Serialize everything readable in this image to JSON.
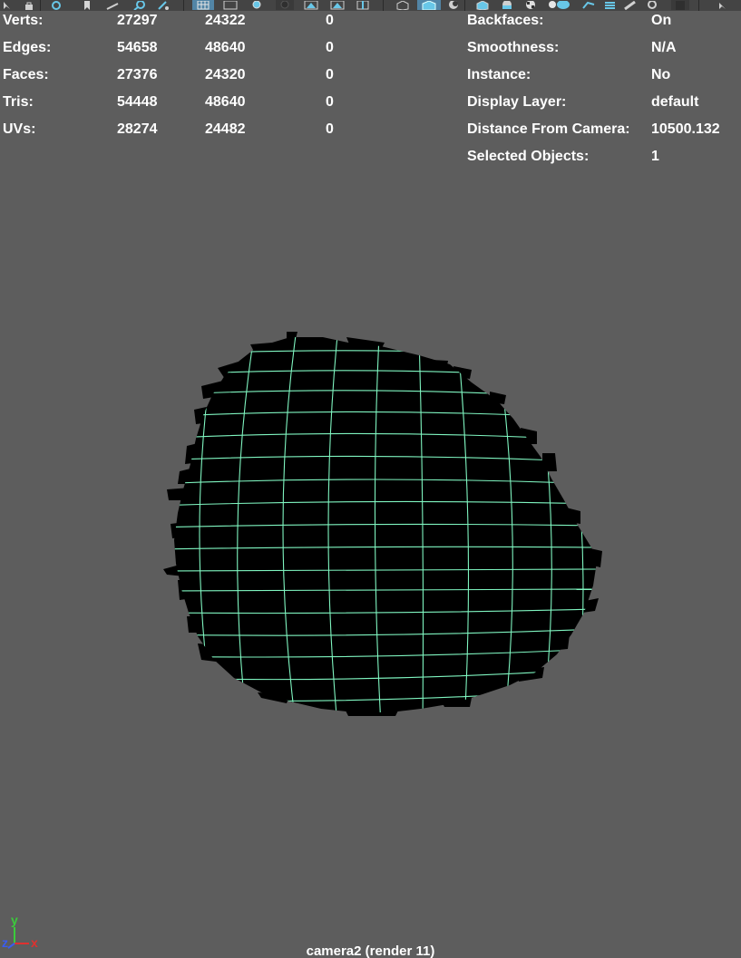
{
  "toolbar": {
    "icons": [
      "select-arrow-icon",
      "lock-icon",
      "snap-settings-icon",
      "bookmark-icon",
      "measure-icon",
      "search-icon",
      "paint-icon",
      "wireframe-grid-icon",
      "film-gate-icon",
      "circle-icon",
      "camera-icon",
      "image-plane-icon",
      "xray-icon",
      "cube-wireframe-icon",
      "cube-shaded-icon",
      "texture-icon",
      "cube-smooth-icon",
      "light-icon",
      "shadow-icon",
      "checker-icon",
      "lightbulb-icon",
      "globe-icon",
      "ambient-occlusion-icon",
      "motion-blur-icon",
      "anti-alias-icon",
      "depth-icon",
      "exposure-icon",
      "gamma-icon",
      "arrow-icon"
    ]
  },
  "hud": {
    "stats": [
      {
        "label": "Verts:",
        "c1": "27297",
        "c2": "24322",
        "c3": "0"
      },
      {
        "label": "Edges:",
        "c1": "54658",
        "c2": "48640",
        "c3": "0"
      },
      {
        "label": "Faces:",
        "c1": "27376",
        "c2": "24320",
        "c3": "0"
      },
      {
        "label": "Tris:",
        "c1": "54448",
        "c2": "48640",
        "c3": "0"
      },
      {
        "label": "UVs:",
        "c1": "28274",
        "c2": "24482",
        "c3": "0"
      }
    ],
    "info": [
      {
        "label": "Backfaces:",
        "value": "On"
      },
      {
        "label": "Smoothness:",
        "value": "N/A"
      },
      {
        "label": "Instance:",
        "value": "No"
      },
      {
        "label": "Display Layer:",
        "value": "default"
      },
      {
        "label": "Distance From Camera:",
        "value": "10500.132"
      },
      {
        "label": "Selected Objects:",
        "value": "1"
      }
    ]
  },
  "axis": {
    "x": "x",
    "y": "y",
    "z": "z",
    "x_color": "#e0312f",
    "y_color": "#3bcb3b",
    "z_color": "#3a5cf0"
  },
  "camera": {
    "name": "camera2 (render  11)"
  },
  "colors": {
    "background": "#5d5d5d",
    "mesh": "#000000",
    "wire": "#7ff5c0",
    "active_button": "#5285a6"
  }
}
